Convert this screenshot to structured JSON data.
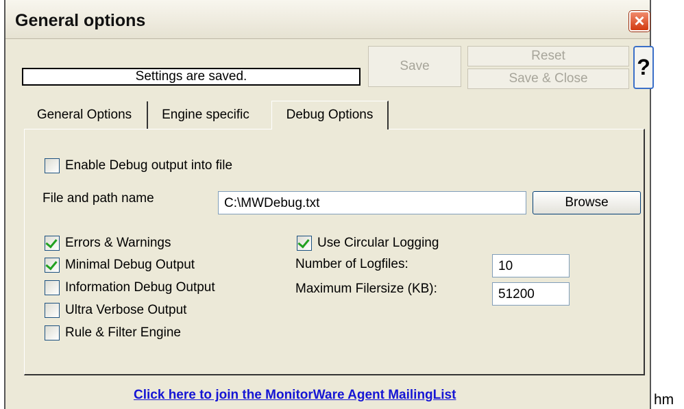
{
  "window": {
    "title": "General options"
  },
  "toolbar": {
    "status_text": "Settings are saved.",
    "save_label": "Save",
    "reset_label": "Reset",
    "save_close_label": "Save & Close",
    "help_label": "?"
  },
  "tabs": [
    {
      "label": "General Options",
      "active": false
    },
    {
      "label": "Engine specific",
      "active": false
    },
    {
      "label": "Debug Options",
      "active": true
    }
  ],
  "debug": {
    "enable_output": {
      "label": "Enable Debug output into file",
      "checked": false
    },
    "file_path_label": "File and path name",
    "file_path_value": "C:\\MWDebug.txt",
    "browse_label": "Browse",
    "levels": [
      {
        "label": "Errors & Warnings",
        "checked": true
      },
      {
        "label": "Minimal Debug Output",
        "checked": true
      },
      {
        "label": "Information Debug Output",
        "checked": false
      },
      {
        "label": "Ultra Verbose Output",
        "checked": false
      },
      {
        "label": "Rule & Filter Engine",
        "checked": false
      }
    ],
    "circular_logging": {
      "label": "Use Circular Logging",
      "checked": true
    },
    "num_logfiles_label": "Number of Logfiles:",
    "num_logfiles_value": "10",
    "max_filesize_label": "Maximum Filersize (KB):",
    "max_filesize_value": "51200"
  },
  "footer": {
    "link_text": "Click here to join the MonitorWare Agent MailingList"
  },
  "outside_text": "hm",
  "colors": {
    "close_button": "#d23a10",
    "link": "#1515d4",
    "checkmark": "#21a121",
    "window_bg": "#ece9d8"
  }
}
